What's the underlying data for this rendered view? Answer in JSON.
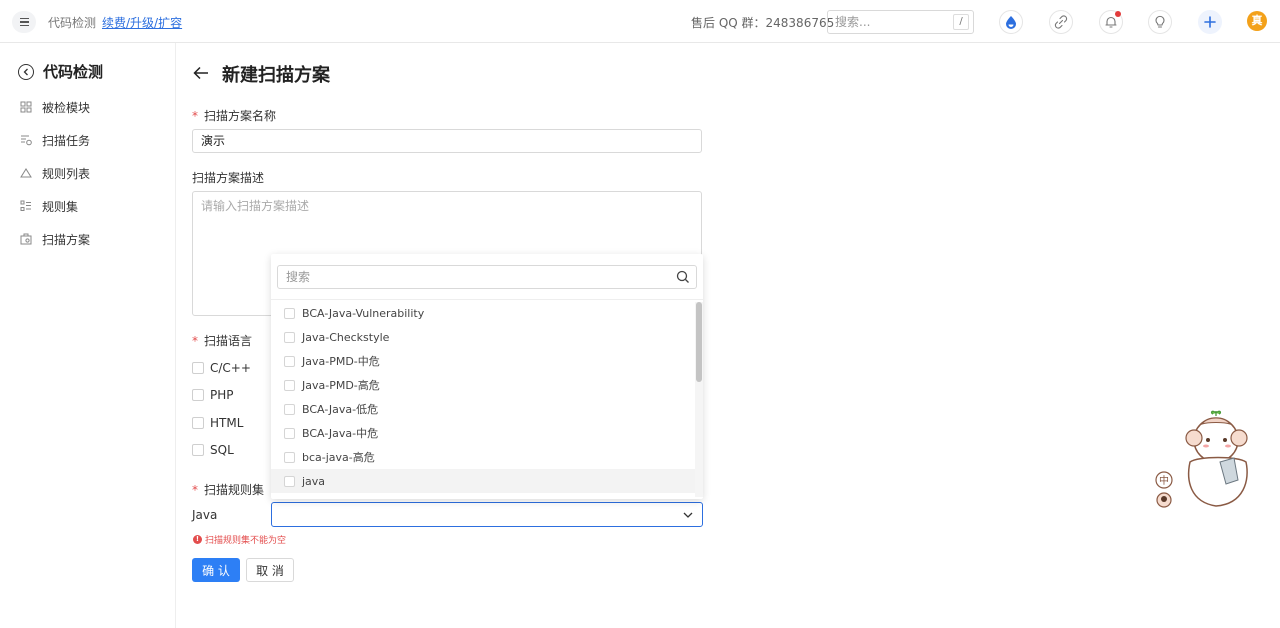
{
  "topbar": {
    "app_title": "代码检测",
    "upgrade_link": "续费/升级/扩容",
    "qq_group": "售后 QQ 群：248386765",
    "search_placeholder": "搜索...",
    "search_shortcut": "/",
    "avatar_text": "真",
    "accent_color": "#2d6fdf"
  },
  "sidebar": {
    "title": "代码检测",
    "items": [
      {
        "label": "被检模块",
        "icon": "grid-icon"
      },
      {
        "label": "扫描任务",
        "icon": "task-list-icon"
      },
      {
        "label": "规则列表",
        "icon": "rule-icon"
      },
      {
        "label": "规则集",
        "icon": "ruleset-icon"
      },
      {
        "label": "扫描方案",
        "icon": "scheme-icon"
      }
    ]
  },
  "main": {
    "page_title": "新建扫描方案",
    "name_field": {
      "label": "扫描方案名称",
      "value": "演示"
    },
    "desc_field": {
      "label": "扫描方案描述",
      "placeholder": "请输入扫描方案描述"
    },
    "language_field": {
      "label": "扫描语言",
      "options": [
        "C/C++",
        "PHP",
        "HTML",
        "SQL"
      ]
    },
    "ruleset_field": {
      "label": "扫描规则集",
      "language": "Java",
      "error": "扫描规则集不能为空"
    },
    "buttons": {
      "confirm": "确 认",
      "cancel": "取 消"
    }
  },
  "dropdown": {
    "search_placeholder": "搜索",
    "options": [
      "BCA-Java-Vulnerability",
      "Java-Checkstyle",
      "Java-PMD-中危",
      "Java-PMD-高危",
      "BCA-Java-低危",
      "BCA-Java-中危",
      "bca-java-高危",
      "java"
    ],
    "hovered_index": 7
  },
  "required_mark": "*",
  "mascot_badge": "中"
}
